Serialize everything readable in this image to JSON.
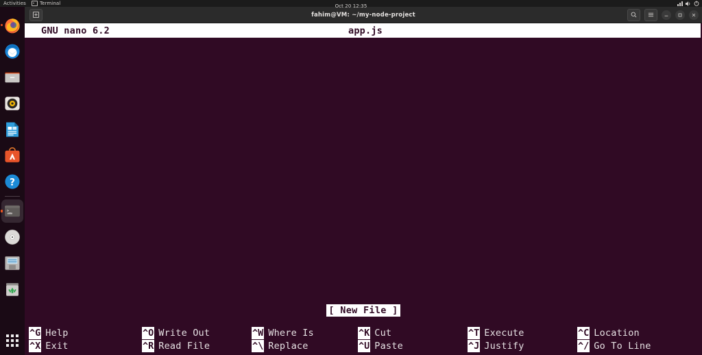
{
  "desktop": {
    "activities_label": "Activities",
    "focused_app": "Terminal",
    "clock": "Oct 20  12:35",
    "system_icons": [
      "network-icon",
      "volume-icon",
      "power-icon"
    ]
  },
  "dock": {
    "items": [
      {
        "name": "firefox",
        "label": "Firefox",
        "running": true
      },
      {
        "name": "thunderbird",
        "label": "Thunderbird",
        "running": false
      },
      {
        "name": "files",
        "label": "Files",
        "running": false
      },
      {
        "name": "rhythmbox",
        "label": "Rhythmbox",
        "running": false
      },
      {
        "name": "libreoffice-writer",
        "label": "LibreOffice Writer",
        "running": false
      },
      {
        "name": "ubuntu-software",
        "label": "Ubuntu Software",
        "running": false
      },
      {
        "name": "help",
        "label": "Help",
        "running": false
      },
      {
        "name": "terminal",
        "label": "Terminal",
        "running": true,
        "active": true
      },
      {
        "name": "disc",
        "label": "CD/DVD Drive",
        "running": false
      },
      {
        "name": "install-media",
        "label": "Install Ubuntu",
        "running": false
      },
      {
        "name": "trash",
        "label": "Trash",
        "running": false
      }
    ],
    "show_apps_label": "Show Applications"
  },
  "terminal_window": {
    "title": "fahim@VM: ~/my-node-project",
    "new_tab_label": "New Tab",
    "controls": {
      "search": "search-icon",
      "menu": "hamburger-menu-icon",
      "minimize": "minimize-icon",
      "maximize": "maximize-icon",
      "close": "close-icon"
    }
  },
  "nano": {
    "version_title": "GNU nano 6.2",
    "filename": "app.js",
    "buffer_text": "",
    "status_message": "[ New File ]",
    "shortcuts_row1": [
      {
        "key": "^G",
        "label": "Help"
      },
      {
        "key": "^O",
        "label": "Write Out"
      },
      {
        "key": "^W",
        "label": "Where Is"
      },
      {
        "key": "^K",
        "label": "Cut"
      },
      {
        "key": "^T",
        "label": "Execute"
      },
      {
        "key": "^C",
        "label": "Location"
      }
    ],
    "shortcuts_row2": [
      {
        "key": "^X",
        "label": "Exit"
      },
      {
        "key": "^R",
        "label": "Read File"
      },
      {
        "key": "^\\",
        "label": "Replace"
      },
      {
        "key": "^U",
        "label": "Paste"
      },
      {
        "key": "^J",
        "label": "Justify"
      },
      {
        "key": "^/",
        "label": "Go To Line"
      }
    ]
  },
  "colors": {
    "terminal_bg": "#300a24",
    "terminal_fg": "#e7e2e4",
    "inverted_bg": "#ffffff",
    "header_bg": "#2b2b2b",
    "topbar_bg": "#1b1b1b",
    "accent": "#e95420"
  }
}
